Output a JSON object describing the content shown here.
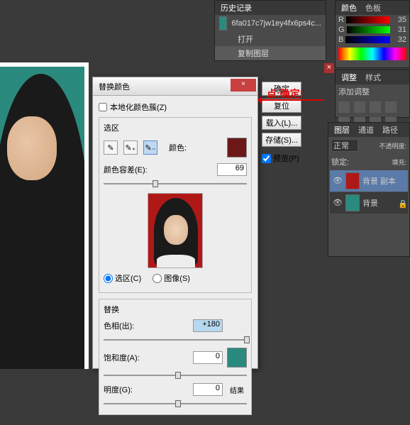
{
  "canvas": {
    "bg_color": "#2a8a7e"
  },
  "dialog": {
    "title": "替换颜色",
    "close": "×",
    "localize_label": "本地化颜色簇(Z)",
    "selection": {
      "group_title": "选区",
      "color_label": "颜色:",
      "tolerance_label": "颜色容差(E):",
      "tolerance_value": "69",
      "radio_selection": "选区(C)",
      "radio_image": "图像(S)"
    },
    "replace": {
      "group_title": "替换",
      "hue_label": "色相(出):",
      "hue_value": "+180",
      "sat_label": "饱和度(A):",
      "sat_value": "0",
      "light_label": "明度(G):",
      "light_value": "0",
      "result_label": "结果"
    },
    "buttons": {
      "ok": "确定",
      "reset": "复位",
      "load": "载入(L)...",
      "save": "存储(S)...",
      "preview": "预览(P)"
    }
  },
  "annotation": {
    "text": "点:确定!"
  },
  "history": {
    "tab": "历史记录",
    "filename": "6fa017c7jw1ey4fx6ps4c...",
    "item1": "打开",
    "item2": "复制图层"
  },
  "color_panel": {
    "tab1": "颜色",
    "tab2": "色板",
    "r": "R",
    "r_val": "35",
    "g": "G",
    "g_val": "31",
    "b": "B",
    "b_val": "32",
    "close_x": "×"
  },
  "adjust": {
    "tab1": "调整",
    "tab2": "样式",
    "title": "添加调整"
  },
  "layers": {
    "tab1": "图层",
    "tab2": "通道",
    "tab3": "路径",
    "mode": "正常",
    "opacity_label": "不透明度:",
    "lock_label": "锁定:",
    "fill_label": "填充:",
    "layer1": "背景 副本",
    "layer2": "背景"
  }
}
